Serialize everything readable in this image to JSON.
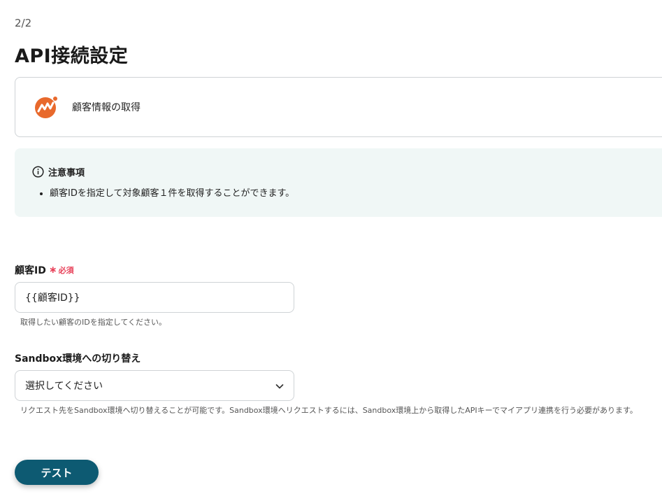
{
  "header": {
    "step": "2/2",
    "title": "API接続設定"
  },
  "action": {
    "label": "顧客情報の取得",
    "logo_color": "#e8692c"
  },
  "notice": {
    "title": "注意事項",
    "items": [
      "顧客IDを指定して対象顧客１件を取得することができます。"
    ]
  },
  "customer_id": {
    "label": "顧客ID",
    "required_mark": "∗",
    "required_text": "必須",
    "value": "{{顧客ID}}",
    "hint": "取得したい顧客のIDを指定してください。"
  },
  "sandbox": {
    "label": "Sandbox環境への切り替え",
    "selected": "選択してください",
    "hint": "リクエスト先をSandbox環境へ切り替えることが可能です。Sandbox環境へリクエストするには、Sandbox環境上から取得したAPIキーでマイアプリ連携を行う必要があります。"
  },
  "test_button": {
    "label": "テスト",
    "color": "#0d5a72"
  },
  "colors": {
    "required": "#e8425a",
    "notice_bg": "#f0f7f6",
    "border": "#cfd3d6"
  }
}
